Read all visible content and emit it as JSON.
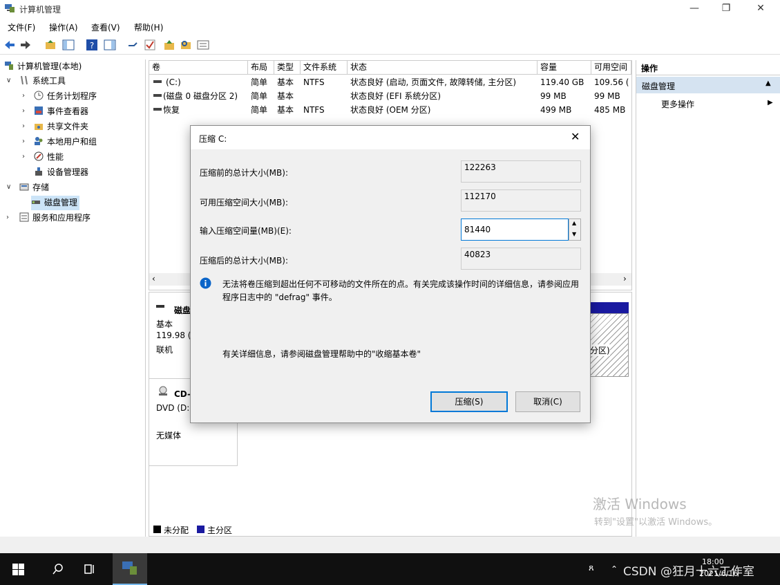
{
  "window": {
    "title": "计算机管理",
    "minimize": "—",
    "maximize": "❐",
    "close": "✕"
  },
  "menu": [
    "文件(F)",
    "操作(A)",
    "查看(V)",
    "帮助(H)"
  ],
  "tree": {
    "root": "计算机管理(本地)",
    "system_tools": "系统工具",
    "task_scheduler": "任务计划程序",
    "event_viewer": "事件查看器",
    "shared_folders": "共享文件夹",
    "local_users": "本地用户和组",
    "performance": "性能",
    "device_manager": "设备管理器",
    "storage": "存储",
    "disk_management": "磁盘管理",
    "services_apps": "服务和应用程序"
  },
  "volumes": {
    "headers": [
      "卷",
      "布局",
      "类型",
      "文件系统",
      "状态",
      "容量",
      "可用空间"
    ],
    "rows": [
      [
        "(C:)",
        "简单",
        "基本",
        "NTFS",
        "状态良好 (启动, 页面文件, 故障转储, 主分区)",
        "119.40 GB",
        "109.56 ("
      ],
      [
        "(磁盘 0 磁盘分区 2)",
        "简单",
        "基本",
        "",
        "状态良好 (EFI 系统分区)",
        "99 MB",
        "99 MB"
      ],
      [
        "恢复",
        "简单",
        "基本",
        "NTFS",
        "状态良好 (OEM 分区)",
        "499 MB",
        "485 MB"
      ]
    ]
  },
  "actions": {
    "header": "操作",
    "section": "磁盘管理",
    "more": "更多操作"
  },
  "disks": {
    "disk0_name": "磁盘",
    "disk0_type": "基本",
    "disk0_size": "119.98 (",
    "disk0_status": "联机",
    "disk0_partition_tail": "分区)",
    "cd_name": "CD-",
    "cd_type": "DVD (D:",
    "cd_media": "无媒体"
  },
  "legend": {
    "unallocated": "未分配",
    "primary": "主分区"
  },
  "watermark": {
    "line1": "激活 Windows",
    "line2": "转到\"设置\"以激活 Windows。"
  },
  "dialog": {
    "title": "压缩 C:",
    "total_before_label": "压缩前的总计大小(MB):",
    "total_before_value": "122263",
    "available_label": "可用压缩空间大小(MB):",
    "available_value": "112170",
    "input_label": "输入压缩空间量(MB)(E):",
    "input_value": "81440",
    "total_after_label": "压缩后的总计大小(MB):",
    "total_after_value": "40823",
    "info_text": "无法将卷压缩到超出任何不可移动的文件所在的点。有关完成该操作时间的详细信息，请参阅应用程序日志中的 \"defrag\" 事件。",
    "help_text": "有关详细信息，请参阅磁盘管理帮助中的\"收缩基本卷\"",
    "shrink_button": "压缩(S)",
    "cancel_button": "取消(C)"
  },
  "taskbar": {
    "time": "18:00",
    "date": "2021/6/16",
    "overlay": "CSDN @狂月十六工作室"
  },
  "colors": {
    "primary_partition": "#1a1aa0",
    "accent": "#0078d7",
    "selected": "#cce4f7"
  }
}
